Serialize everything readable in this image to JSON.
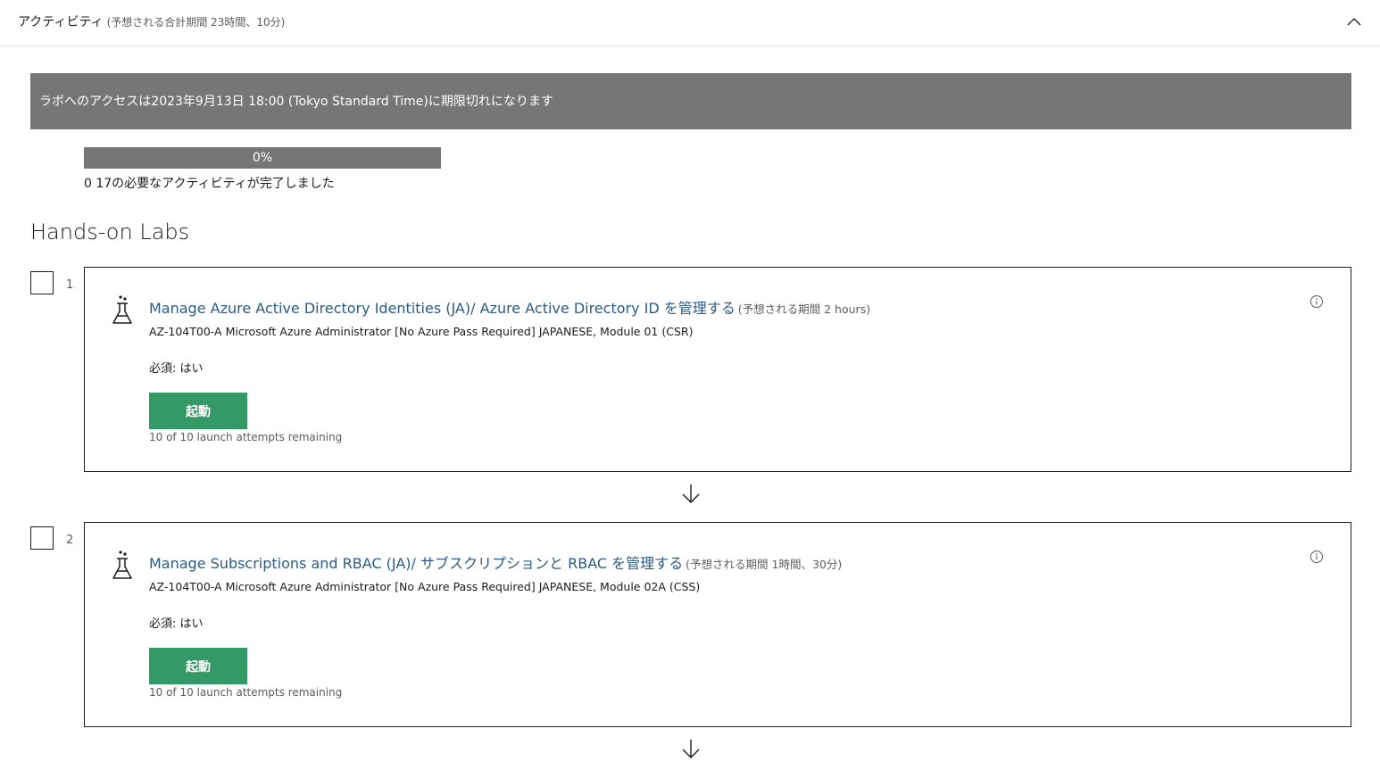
{
  "section": {
    "title": "アクティビティ",
    "subtitle": "(予想される合計期間 23時間、10分)"
  },
  "banner": {
    "text": "ラボへのアクセスは2023年9月13日 18:00 (Tokyo Standard Time)に期限切れになります"
  },
  "progress": {
    "percent": 0,
    "label": "0%",
    "status": "0 17の必要なアクティビティが完了しました"
  },
  "labs_heading": "Hands-on Labs",
  "labs": [
    {
      "number": "1",
      "title": "Manage Azure Active Directory Identities (JA)/ Azure Active Directory ID を管理する",
      "duration": "(予想される期間 2 hours)",
      "course": "AZ-104T00-A Microsoft Azure Administrator [No Azure Pass Required] JAPANESE, Module 01 (CSR)",
      "required": "必須: はい",
      "launch_label": "起動",
      "attempts": "10 of 10 launch attempts remaining"
    },
    {
      "number": "2",
      "title": "Manage Subscriptions and RBAC (JA)/ サブスクリプションと RBAC を管理する",
      "duration": "(予想される期間 1時間、30分)",
      "course": "AZ-104T00-A Microsoft Azure Administrator [No Azure Pass Required] JAPANESE, Module 02A (CSS)",
      "required": "必須: はい",
      "launch_label": "起動",
      "attempts": "10 of 10 launch attempts remaining"
    }
  ],
  "colors": {
    "banner_bg": "#767676",
    "launch_button": "#339966",
    "lab_title": "#2c5a84"
  },
  "icons": {
    "collapse": "chevron-up-icon",
    "lab": "flask-icon",
    "info": "info-icon",
    "connector": "arrow-down-icon"
  }
}
